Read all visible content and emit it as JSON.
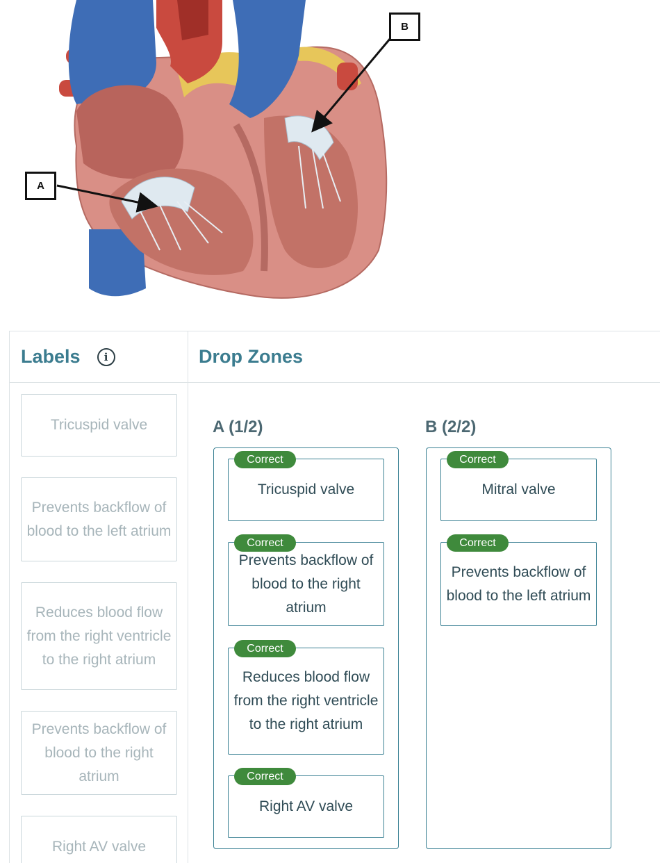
{
  "diagram": {
    "callouts": [
      {
        "id": "A",
        "label": "A"
      },
      {
        "id": "B",
        "label": "B"
      }
    ]
  },
  "labels_panel": {
    "title": "Labels",
    "info_icon": "info-icon",
    "items": [
      "Tricuspid valve",
      "Prevents backflow of blood to the left atrium",
      "Reduces blood flow from the right ventricle to the right atrium",
      "Prevents backflow of blood to the right atrium",
      "Right AV valve"
    ]
  },
  "drop_zones": {
    "title": "Drop Zones",
    "zones": [
      {
        "title": "A (1/2)",
        "items": [
          {
            "badge": "Correct",
            "text": "Tricuspid valve"
          },
          {
            "badge": "Correct",
            "text": "Prevents backflow of blood to the right atrium"
          },
          {
            "badge": "Correct",
            "text": "Reduces blood flow from the right ventricle to the right atrium"
          },
          {
            "badge": "Correct",
            "text": "Right AV valve"
          }
        ]
      },
      {
        "title": "B (2/2)",
        "items": [
          {
            "badge": "Correct",
            "text": "Mitral valve"
          },
          {
            "badge": "Correct",
            "text": "Prevents backflow of blood to the left atrium"
          }
        ]
      }
    ]
  },
  "colors": {
    "accent": "#3b7c8f",
    "zone_border": "#3a8093",
    "badge": "#3f8a3c",
    "muted_text": "#a7b5ba"
  }
}
